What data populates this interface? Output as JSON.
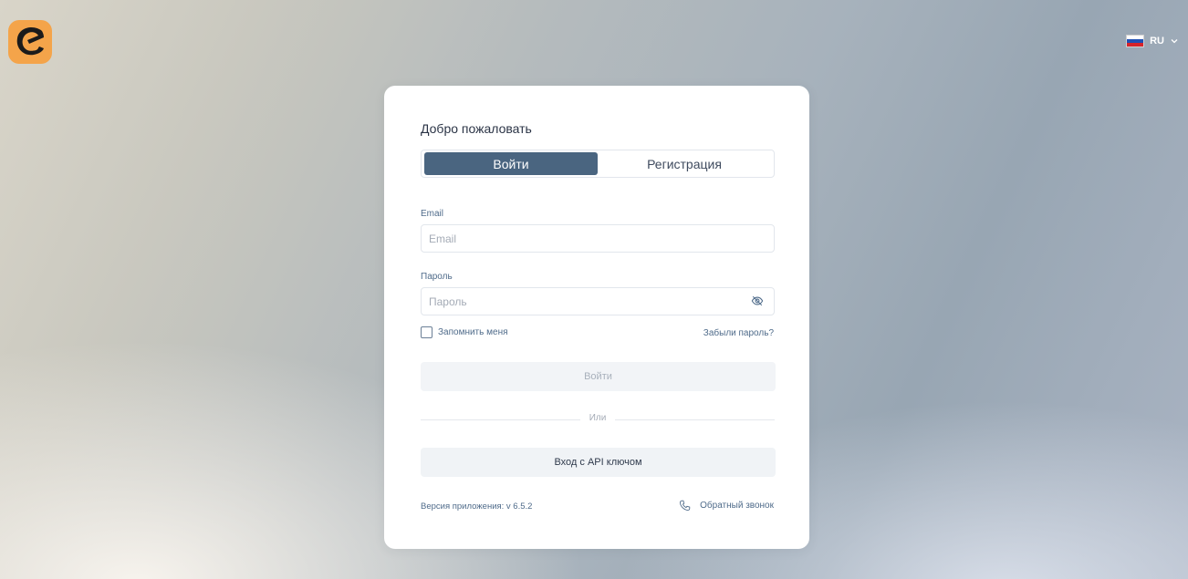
{
  "header": {
    "logo_icon": "brand-logo-icon",
    "language": {
      "code": "RU",
      "flag_icon": "russia-flag-icon",
      "chevron_icon": "chevron-down-icon"
    }
  },
  "card": {
    "title": "Добро пожаловать",
    "tabs": [
      {
        "label": "Войти",
        "active": true
      },
      {
        "label": "Регистрация",
        "active": false
      }
    ],
    "email": {
      "label": "Email",
      "placeholder": "Email",
      "value": ""
    },
    "password": {
      "label": "Пароль",
      "placeholder": "Пароль",
      "value": "",
      "toggle_icon": "eye-off-icon"
    },
    "remember_label": "Запомнить меня",
    "forgot_label": "Забыли пароль?",
    "login_button": "Войти",
    "divider_text": "Или",
    "api_button": "Вход с API ключом",
    "version_text": "Версия приложения: v 6.5.2",
    "callback_label": "Обратный звонок",
    "callback_icon": "phone-icon"
  },
  "colors": {
    "primary": "#4a6580",
    "logo_bg": "#f4a44a",
    "text_muted": "#4f6b8a"
  }
}
